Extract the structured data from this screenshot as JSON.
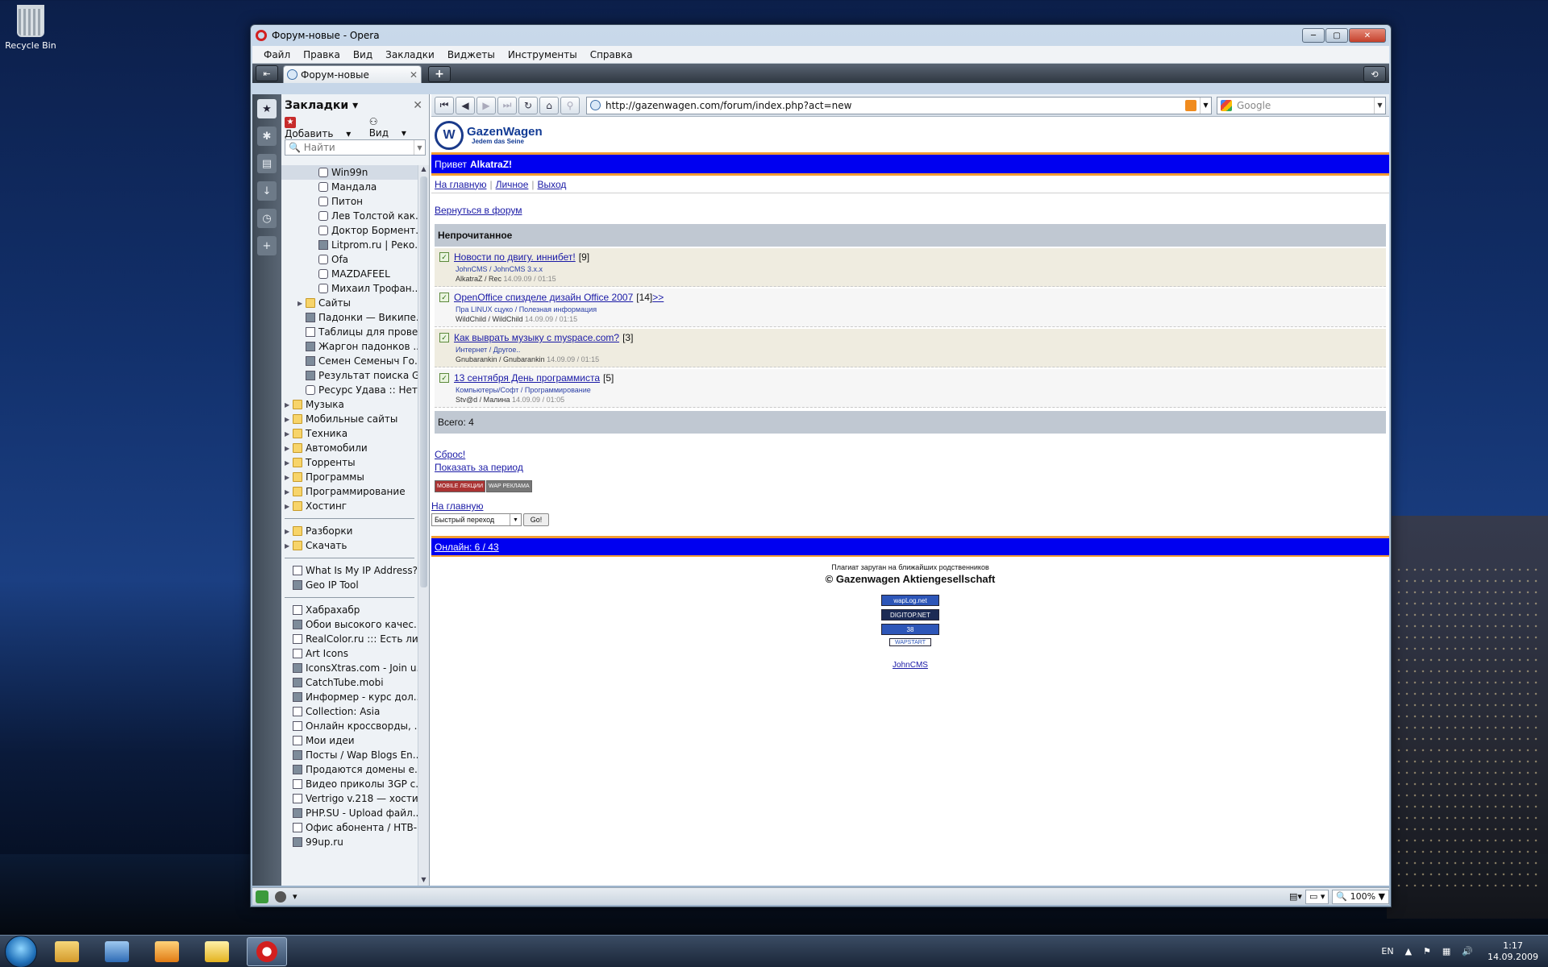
{
  "desktop": {
    "recycle_bin": "Recycle Bin"
  },
  "window": {
    "title": "Форум-новые - Opera"
  },
  "menu": [
    "Файл",
    "Правка",
    "Вид",
    "Закладки",
    "Виджеты",
    "Инструменты",
    "Справка"
  ],
  "tab": {
    "title": "Форум-новые"
  },
  "panel": {
    "title": "Закладки",
    "add_label": "Добавить",
    "view_label": "Вид",
    "search_placeholder": "Найти",
    "bookmarks_a": [
      {
        "label": "Win99n",
        "icon": "robot",
        "indent": 2,
        "selected": true
      },
      {
        "label": "Мандала",
        "icon": "robot",
        "indent": 2
      },
      {
        "label": "Питон",
        "icon": "robot",
        "indent": 2
      },
      {
        "label": "Лев Толстой как...",
        "icon": "robot",
        "indent": 2
      },
      {
        "label": "Доктор Бормент...",
        "icon": "robot",
        "indent": 2
      },
      {
        "label": "Litprom.ru | Реко...",
        "icon": "star",
        "indent": 2
      },
      {
        "label": "Ofa",
        "icon": "robot",
        "indent": 2
      },
      {
        "label": "MAZDAFEEL",
        "icon": "robot",
        "indent": 2
      },
      {
        "label": "Михаил Трофан...",
        "icon": "robot",
        "indent": 2
      },
      {
        "label": "Сайты",
        "icon": "folder",
        "indent": 1,
        "expandable": true
      },
      {
        "label": "Падонки — Википе...",
        "icon": "star",
        "indent": 1
      },
      {
        "label": "Таблицы для прове...",
        "icon": "page",
        "indent": 1
      },
      {
        "label": "Жаргон падонков ...",
        "icon": "star",
        "indent": 1
      },
      {
        "label": "Семен Семеныч Го...",
        "icon": "star",
        "indent": 1
      },
      {
        "label": "Результат поиска G...",
        "icon": "star",
        "indent": 1
      },
      {
        "label": "Ресурс Удава :: Нет...",
        "icon": "robot",
        "indent": 1
      },
      {
        "label": "Музыка",
        "icon": "folder",
        "indent": 0,
        "expandable": true
      },
      {
        "label": "Мобильные сайты",
        "icon": "folder",
        "indent": 0,
        "expandable": true
      },
      {
        "label": "Техника",
        "icon": "folder",
        "indent": 0,
        "expandable": true
      },
      {
        "label": "Автомобили",
        "icon": "folder",
        "indent": 0,
        "expandable": true
      },
      {
        "label": "Торренты",
        "icon": "folder",
        "indent": 0,
        "expandable": true
      },
      {
        "label": "Программы",
        "icon": "folder",
        "indent": 0,
        "expandable": true
      },
      {
        "label": "Программирование",
        "icon": "folder",
        "indent": 0,
        "expandable": true
      },
      {
        "label": "Хостинг",
        "icon": "folder",
        "indent": 0,
        "expandable": true
      }
    ],
    "bookmarks_b": [
      {
        "label": "Разборки",
        "icon": "folder",
        "indent": 0,
        "expandable": true
      },
      {
        "label": "Скачать",
        "icon": "folder",
        "indent": 0,
        "expandable": true
      }
    ],
    "bookmarks_c": [
      {
        "label": "What Is My IP Address?...",
        "icon": "page",
        "indent": 0
      },
      {
        "label": "Geo IP Tool",
        "icon": "star",
        "indent": 0
      }
    ],
    "bookmarks_d": [
      {
        "label": "Хабрахабр",
        "icon": "page",
        "indent": 0
      },
      {
        "label": "Обои высокого качес...",
        "icon": "star",
        "indent": 0
      },
      {
        "label": "RealColor.ru ::: Есть ли ...",
        "icon": "page",
        "indent": 0
      },
      {
        "label": "Art Icons",
        "icon": "page",
        "indent": 0
      },
      {
        "label": "IconsXtras.com - Join u...",
        "icon": "star",
        "indent": 0
      },
      {
        "label": "CatchTube.mobi",
        "icon": "star",
        "indent": 0
      },
      {
        "label": "Информер - курс дол...",
        "icon": "star",
        "indent": 0
      },
      {
        "label": "Collection: Asia",
        "icon": "page",
        "indent": 0
      },
      {
        "label": "Онлайн кроссворды, ...",
        "icon": "page",
        "indent": 0
      },
      {
        "label": "Мои идеи",
        "icon": "page",
        "indent": 0
      },
      {
        "label": "Посты / Wap Blogs En...",
        "icon": "star",
        "indent": 0
      },
      {
        "label": "Продаются домены е...",
        "icon": "star",
        "indent": 0
      },
      {
        "label": "Видео приколы 3GP с...",
        "icon": "page",
        "indent": 0
      },
      {
        "label": "Vertrigo v.218 — хости...",
        "icon": "page",
        "indent": 0
      },
      {
        "label": "PHP.SU - Upload файл...",
        "icon": "star",
        "indent": 0
      },
      {
        "label": "Офис абонента / НТВ-...",
        "icon": "page",
        "indent": 0
      },
      {
        "label": "99up.ru",
        "icon": "star",
        "indent": 0
      }
    ]
  },
  "address": {
    "url": "http://gazenwagen.com/forum/index.php?act=new",
    "search_placeholder": "Google"
  },
  "site": {
    "logo_name": "GazenWagen",
    "logo_sub": "Jedem das Seine",
    "greeting": "Привет",
    "username": "AlkatraZ!",
    "nav": [
      "На главную",
      "Личное",
      "Выход"
    ],
    "back": "Вернуться в форум",
    "section_title": "Непрочитанное",
    "topics": [
      {
        "title": "Новости по двигу. иннибет!",
        "count": "[9]",
        "extra": "",
        "cat": "JohnCMS / JohnCMS 3.x.x",
        "authors": "AlkatraZ / Rec",
        "time": "14.09.09 / 01:15"
      },
      {
        "title": "OpenOffice спизделе дизайн Office 2007",
        "count": "[14]",
        "extra": " >>",
        "cat": "Пра LINUX сцуко / Полезная информация",
        "authors": "WildChild / WildChild",
        "time": "14.09.09 / 01:15"
      },
      {
        "title": "Как выврать музыку с myspace.com?",
        "count": "[3]",
        "extra": "",
        "cat": "Интернет / Другое..",
        "authors": "Gnubarankin / Gnubarankin",
        "time": "14.09.09 / 01:15"
      },
      {
        "title": "13 сентября День программиста",
        "count": "[5]",
        "extra": "",
        "cat": "Компьютеры/Софт / Программирование",
        "authors": "Stv@d / Малина",
        "time": "14.09.09 / 01:05"
      }
    ],
    "total": "Всего: 4",
    "reset": "Сброс!",
    "period": "Показать за период",
    "banner1": "MOBILE ЛЕКЦИИ",
    "banner2": "WAP РЕКЛАМА",
    "home2": "На главную",
    "quick_jump": "Быстрый переход",
    "go": "Go!",
    "online": "Онлайн: 6 / 43",
    "footer_small": "Плагиат заруган на ближайших родственников",
    "footer_copy": "© Gazenwagen Aktiengesellschaft",
    "counters": [
      "wapLog.net",
      "DIGITOP.NET",
      "38",
      "WAPSTART"
    ],
    "johncms": "JohnCMS"
  },
  "status": {
    "zoom": "100%"
  },
  "taskbar": {
    "lang": "EN",
    "time": "1:17",
    "date": "14.09.2009"
  }
}
